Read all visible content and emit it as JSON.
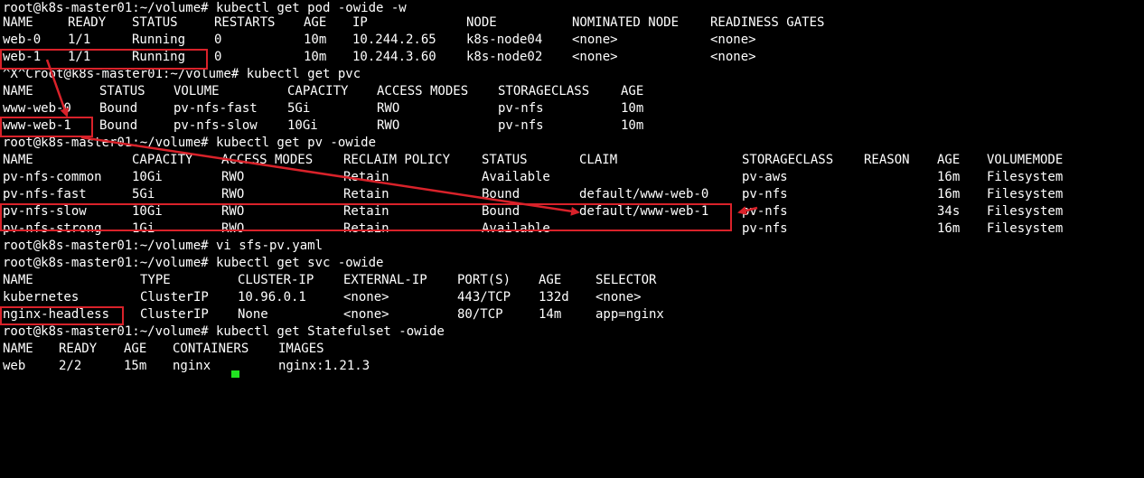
{
  "terminal": {
    "lines": [
      {
        "cells": [
          "root@k8s-master01:~/volume# kubectl get pod -owide -w"
        ]
      },
      {
        "cells": [
          "NAME",
          "READY",
          "STATUS",
          "RESTARTS",
          "AGE",
          "IP",
          "NODE",
          "NOMINATED NODE",
          "READINESS GATES"
        ]
      },
      {
        "cells": [
          "web-0",
          "1/1",
          "Running",
          "0",
          "10m",
          "10.244.2.65",
          "k8s-node04",
          "<none>",
          "<none>"
        ]
      },
      {
        "cells": [
          "web-1",
          "1/1",
          "Running",
          "0",
          "10m",
          "10.244.3.60",
          "k8s-node02",
          "<none>",
          "<none>"
        ]
      },
      {
        "cells": [
          "^X^Croot@k8s-master01:~/volume# kubectl get pvc"
        ]
      },
      {
        "cells": [
          "NAME",
          "STATUS",
          "VOLUME",
          "CAPACITY",
          "ACCESS MODES",
          "STORAGECLASS",
          "AGE"
        ]
      },
      {
        "cells": [
          "www-web-0",
          "Bound",
          "pv-nfs-fast",
          "5Gi",
          "RWO",
          "pv-nfs",
          "10m"
        ]
      },
      {
        "cells": [
          "www-web-1",
          "Bound",
          "pv-nfs-slow",
          "10Gi",
          "RWO",
          "pv-nfs",
          "10m"
        ]
      },
      {
        "cells": [
          "root@k8s-master01:~/volume# kubectl get pv -owide"
        ]
      },
      {
        "cells": [
          "NAME",
          "CAPACITY",
          "ACCESS MODES",
          "RECLAIM POLICY",
          "STATUS",
          "CLAIM",
          "STORAGECLASS",
          "REASON",
          "AGE",
          "VOLUMEMODE"
        ]
      },
      {
        "cells": [
          "pv-nfs-common",
          "10Gi",
          "RWO",
          "Retain",
          "Available",
          "",
          "pv-aws",
          "",
          "16m",
          "Filesystem"
        ]
      },
      {
        "cells": [
          "pv-nfs-fast",
          "5Gi",
          "RWO",
          "Retain",
          "Bound",
          "default/www-web-0",
          "pv-nfs",
          "",
          "16m",
          "Filesystem"
        ]
      },
      {
        "cells": [
          "pv-nfs-slow",
          "10Gi",
          "RWO",
          "Retain",
          "Bound",
          "default/www-web-1",
          "pv-nfs",
          "",
          "34s",
          "Filesystem"
        ]
      },
      {
        "cells": [
          "pv-nfs-strong",
          "1Gi",
          "RWO",
          "Retain",
          "Available",
          "",
          "pv-nfs",
          "",
          "16m",
          "Filesystem"
        ]
      },
      {
        "cells": [
          "root@k8s-master01:~/volume# vi sfs-pv.yaml"
        ]
      },
      {
        "cells": [
          "root@k8s-master01:~/volume# kubectl get svc -owide"
        ]
      },
      {
        "cells": [
          "NAME",
          "TYPE",
          "CLUSTER-IP",
          "EXTERNAL-IP",
          "PORT(S)",
          "AGE",
          "SELECTOR"
        ]
      },
      {
        "cells": [
          "kubernetes",
          "ClusterIP",
          "10.96.0.1",
          "<none>",
          "443/TCP",
          "132d",
          "<none>"
        ]
      },
      {
        "cells": [
          "nginx-headless",
          "ClusterIP",
          "None",
          "<none>",
          "80/TCP",
          "14m",
          "app=nginx"
        ]
      },
      {
        "cells": [
          "root@k8s-master01:~/volume# kubectl get Statefulset -owide"
        ]
      },
      {
        "cells": [
          "NAME",
          "READY",
          "AGE",
          "CONTAINERS",
          "IMAGES"
        ]
      },
      {
        "cells": [
          "web",
          "2/2",
          "15m",
          "nginx",
          "nginx:1.21.3"
        ]
      }
    ]
  },
  "colors": {
    "background": "#000000",
    "text": "#ffffff",
    "annotation": "#d9222a",
    "cursor": "#21e221"
  }
}
